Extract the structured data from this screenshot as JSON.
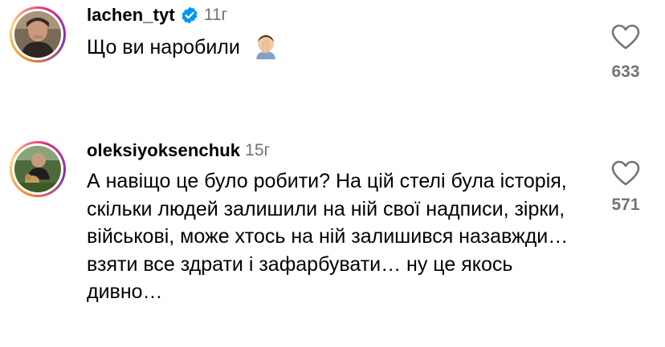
{
  "comments": [
    {
      "username": "lachen_tyt",
      "time": "11г",
      "verified": true,
      "text": "Що ви наробили",
      "emoji_icon": "face-palm-emoji-icon",
      "likes": "633"
    },
    {
      "username": "oleksiyoksenchuk",
      "time": "15г",
      "verified": false,
      "text": "А навіщо це було робити? На цій стелі була історія, скільки людей залишили на ній свої надписи, зірки, військові, може хтось на ній залишився назавжди… взяти все здрати і зафарбувати… ну це якось дивно…",
      "likes": "571"
    }
  ],
  "colors": {
    "meta_gray": "#737373",
    "verified_blue": "#0095f6"
  }
}
